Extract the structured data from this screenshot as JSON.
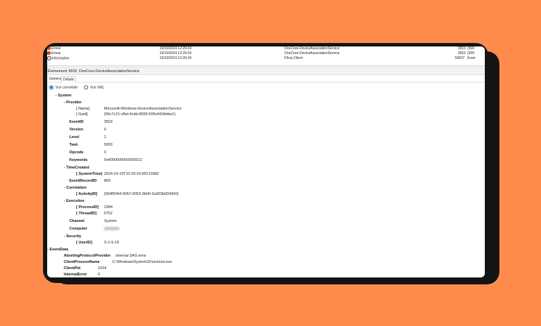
{
  "events": [
    {
      "level": "Erreur",
      "icon": "error-icon",
      "datetime": "19/10/2024 12:29:24",
      "source": "OneCore-DeviceAssociationService",
      "id": "3503",
      "category": "(500"
    },
    {
      "level": "Erreur",
      "icon": "error-icon",
      "datetime": "19/10/2024 12:29:24",
      "source": "OneCore-DeviceAssociationService",
      "id": "3503",
      "category": "(500"
    },
    {
      "level": "Information",
      "icon": "info-icon",
      "datetime": "19/10/2024 12:29:24",
      "source": "Dhcp-Client",
      "id": "50037",
      "category": "Éven"
    }
  ],
  "event_title": "Événement 3503, OneCore-DeviceAssociationService",
  "tabs": {
    "general": "Général",
    "details": "Détails"
  },
  "view": {
    "friendly": "Vue conviviale",
    "xml": "Vue XML"
  },
  "tree": {
    "system": "System",
    "provider": "Provider",
    "name_key": "[ Name]",
    "name_val": "Microsoft-Windows-DeviceAssociationService",
    "guid_key": "[ Guid]",
    "guid_val": "{56c7c31-cfbd-4cdd-8559-505e042bbbe1}",
    "eventid_key": "EventID",
    "eventid_val": "3503",
    "version_key": "Version",
    "version_val": "0",
    "level_key": "Level",
    "level_val": "2",
    "task_key": "Task",
    "task_val": "5000",
    "opcode_key": "Opcode",
    "opcode_val": "0",
    "keywords_key": "Keywords",
    "keywords_val": "0x4000000000000012",
    "timecreated": "TimeCreated",
    "systemtime_key": "[ SystemTime]",
    "systemtime_val": "2024-10-19T10:29:24.9621268Z",
    "recordid_key": "EventRecordID",
    "recordid_val": "869",
    "correlation": "Correlation",
    "activityid_key": "[ ActivityID]",
    "activityid_val": "{004f0044-0057-0053-3b00-2e003b004300}",
    "execution": "Execution",
    "processid_key": "[ ProcessID]",
    "processid_val": "2384",
    "threadid_key": "[ ThreadID]",
    "threadid_val": "5752",
    "channel_key": "Channel",
    "channel_val": "System",
    "computer_key": "Computer",
    "security": "Security",
    "userid_key": "[ UserID]",
    "userid_val": "S-1-5-18",
    "eventdata": "EventData",
    "aborting_key": "AbortingProtocolProvider",
    "aborting_val": "internal DAS error",
    "clientproc_key": "ClientProcessName",
    "clientproc_val": "C:\\Windows\\System32\\svchost.exe",
    "clientpid_key": "ClientPid",
    "clientpid_val": "1524",
    "internalerr_key": "InternalError",
    "internalerr_val": "0"
  }
}
